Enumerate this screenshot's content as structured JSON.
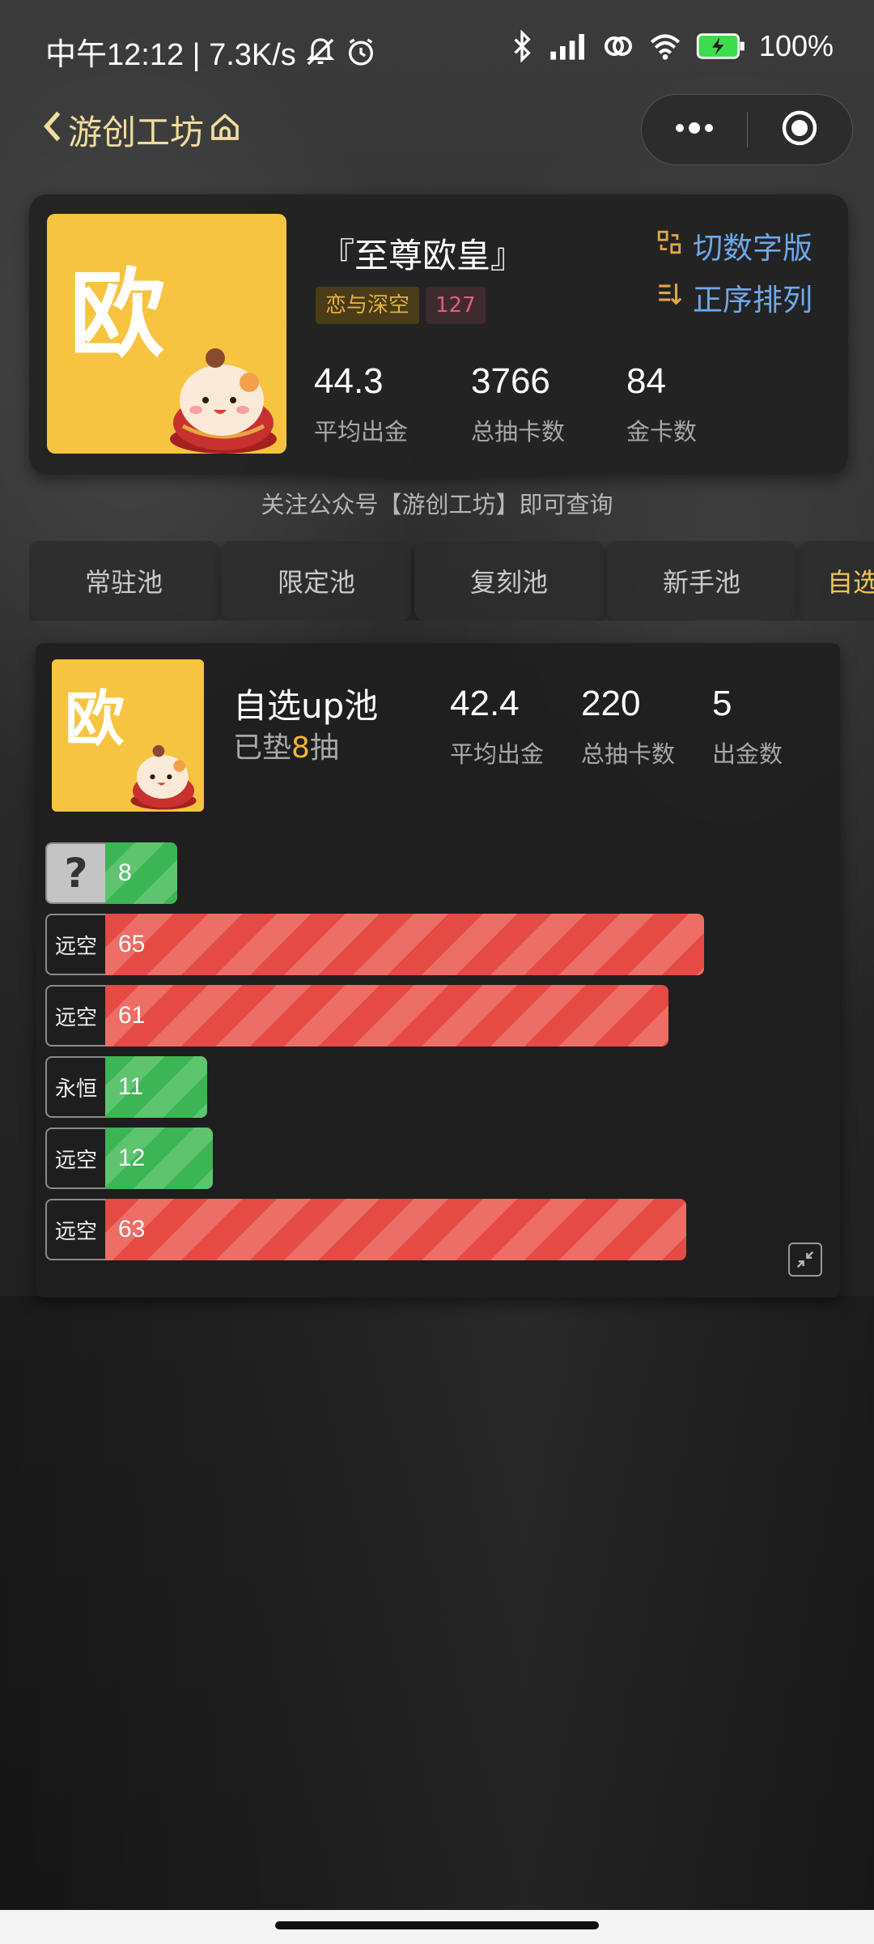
{
  "status_bar": {
    "time_text": "中午12:12 | 7.3K/s",
    "battery_text": "100%"
  },
  "nav": {
    "back_label": "游创工坊"
  },
  "profile": {
    "avatar_char": "欧",
    "title": "『至尊欧皇』",
    "game_tag": "恋与深空",
    "count_tag": "127",
    "option_digital": "切数字版",
    "option_sort": "正序排列",
    "stats": [
      {
        "value": "44.3",
        "label": "平均出金"
      },
      {
        "value": "3766",
        "label": "总抽卡数"
      },
      {
        "value": "84",
        "label": "金卡数"
      }
    ]
  },
  "notice": "关注公众号【游创工坊】即可查询",
  "tabs": [
    {
      "label": "常驻池"
    },
    {
      "label": "限定池"
    },
    {
      "label": "复刻池"
    },
    {
      "label": "新手池"
    },
    {
      "label": "自选"
    }
  ],
  "pool": {
    "avatar_char": "欧",
    "name": "自选up池",
    "pity_prefix": "已垫",
    "pity_value": "8",
    "pity_suffix": "抽",
    "stats": [
      {
        "value": "42.4",
        "label": "平均出金"
      },
      {
        "value": "220",
        "label": "总抽卡数"
      },
      {
        "value": "5",
        "label": "出金数"
      }
    ],
    "pulls": [
      {
        "label": "?",
        "count": "8",
        "fraction": 0.12,
        "color": "green"
      },
      {
        "label": "远空",
        "count": "65",
        "fraction": 1.0,
        "color": "red"
      },
      {
        "label": "远空",
        "count": "61",
        "fraction": 0.94,
        "color": "red"
      },
      {
        "label": "永恒",
        "count": "11",
        "fraction": 0.17,
        "color": "green"
      },
      {
        "label": "远空",
        "count": "12",
        "fraction": 0.18,
        "color": "green"
      },
      {
        "label": "远空",
        "count": "63",
        "fraction": 0.97,
        "color": "red"
      }
    ]
  },
  "colors": {
    "accent_gold": "#f0c55a",
    "link_blue": "#6ea8ec",
    "bar_green": "#3cb554",
    "bar_red": "#e54a45",
    "avatar_yellow": "#f6c440"
  }
}
